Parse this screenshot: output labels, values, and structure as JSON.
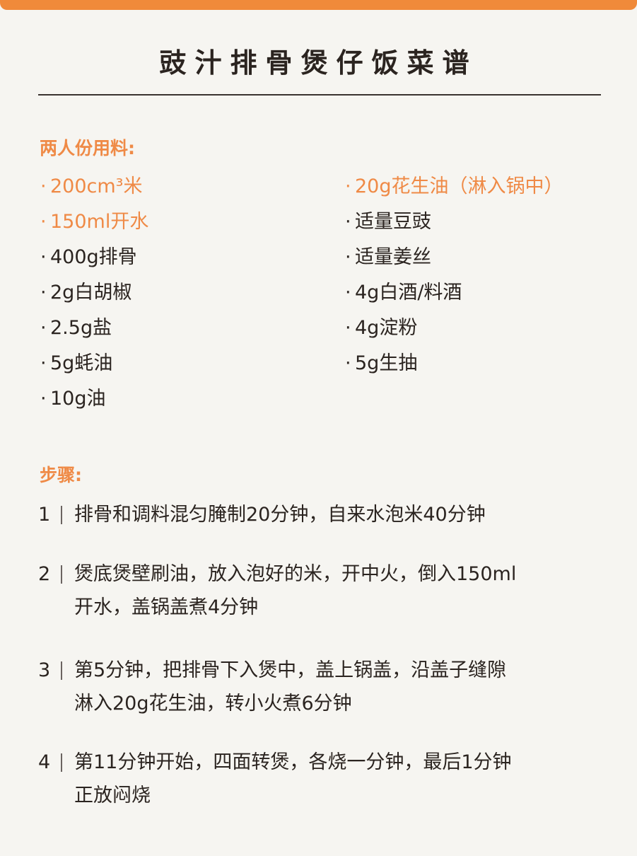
{
  "recipe": {
    "title": "豉汁排骨煲仔饭菜谱",
    "ingredients_heading": "两人份用料:",
    "ingredients_left": [
      {
        "text": "200cm³米",
        "highlight": true
      },
      {
        "text": "150ml开水",
        "highlight": true
      },
      {
        "text": "400g排骨",
        "highlight": false
      },
      {
        "text": "2g白胡椒",
        "highlight": false
      },
      {
        "text": "2.5g盐",
        "highlight": false
      },
      {
        "text": "5g蚝油",
        "highlight": false
      },
      {
        "text": "10g油",
        "highlight": false
      }
    ],
    "ingredients_right": [
      {
        "text": "20g花生油（淋入锅中）",
        "highlight": true
      },
      {
        "text": "适量豆豉",
        "highlight": false
      },
      {
        "text": "适量姜丝",
        "highlight": false
      },
      {
        "text": "4g白酒/料酒",
        "highlight": false
      },
      {
        "text": "4g淀粉",
        "highlight": false
      },
      {
        "text": "5g生抽",
        "highlight": false
      }
    ],
    "steps_heading": "步骤:",
    "steps": [
      {
        "number": "1",
        "text": "排骨和调料混匀腌制20分钟，自来水泡米40分钟"
      },
      {
        "number": "2",
        "text": "煲底煲壁刷油，放入泡好的米，开中火，倒入150ml\n开水，盖锅盖煮4分钟"
      },
      {
        "number": "3",
        "text": "第5分钟，把排骨下入煲中，盖上锅盖，沿盖子缝隙\n淋入20g花生油，转小火煮6分钟"
      },
      {
        "number": "4",
        "text": "第11分钟开始，四面转煲，各烧一分钟，最后1分钟\n正放闷烧"
      }
    ]
  },
  "colors": {
    "accent": "#ef8a46",
    "text": "#2b2420",
    "background": "#f6f5f1"
  }
}
